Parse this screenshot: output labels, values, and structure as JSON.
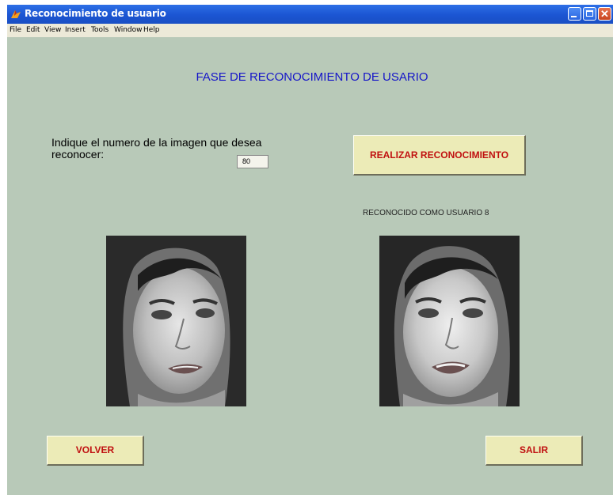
{
  "window": {
    "title": "Reconocimiento de usuario",
    "icon": "matlab-figure-icon",
    "controls": [
      "minimize-icon",
      "maximize-icon",
      "close-icon"
    ]
  },
  "menu": {
    "items": [
      "File",
      "Edit",
      "View",
      "Insert",
      "Tools",
      "Window",
      "Help"
    ]
  },
  "main": {
    "heading": "FASE DE RECONOCIMIENTO DE USARIO",
    "prompt": "Indique el numero de la imagen que desea reconocer:",
    "image_number": "80",
    "recognize_button": "REALIZAR RECONOCIMIENTO",
    "result_text": "RECONOCIDO COMO USUARIO 8",
    "back_button": "VOLVER",
    "exit_button": "SALIR"
  },
  "colors": {
    "background": "#b8c9b8",
    "heading_text": "#1616c8",
    "button_face": "#ecebb7",
    "button_text": "#c01010"
  }
}
